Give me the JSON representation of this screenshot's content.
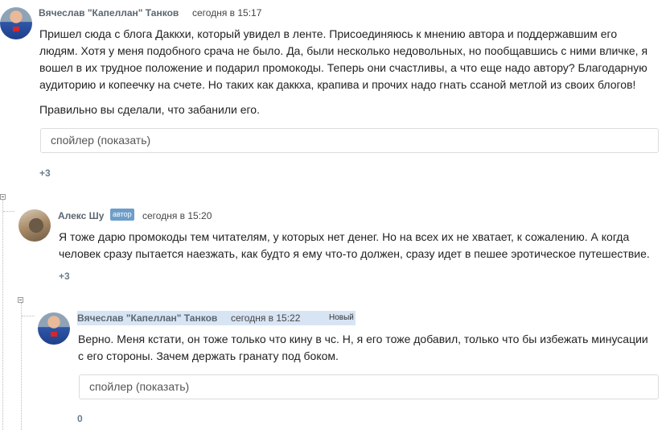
{
  "comments": [
    {
      "author": "Вячеслав \"Капеллан\" Танков",
      "time": "сегодня в 15:17",
      "lines": [
        "Пришел сюда с блога Даккхи, который увидел в ленте. Присоединяюсь к мнению автора и поддержавшим его",
        "людям. Хотя у меня подобного срача не было. Да, были несколько недовольных, но пообщавшись с ними вличке, я",
        "вошел в их трудное положение и подарил промокоды. Теперь они счастливы, а что еще надо автору? Благодарную",
        "аудиторию и копеечку на счете. Но таких как даккха, крапива и прочих надо гнать ссаной метлой из своих блогов!"
      ],
      "line2": "Правильно вы сделали, что забанили его.",
      "spoiler": "спойлер (показать)",
      "score": "+3"
    },
    {
      "author": "Алекс Шу",
      "badge": "автор",
      "time": "сегодня в 15:20",
      "lines": [
        "Я тоже дарю промокоды тем читателям, у которых нет денег. Но на всех их не хватает, к сожалению. А когда",
        "человек сразу пытается наезжать, как будто я ему что-то должен, сразу идет в пешее эротическое путешествие."
      ],
      "score": "+3"
    },
    {
      "author": "Вячеслав \"Капеллан\" Танков",
      "time": "сегодня в 15:22",
      "new_tag": "Новый",
      "lines": [
        "Верно. Меня кстати, он тоже только что кину в чс. Н, я его тоже добавил, только что бы избежать минусации",
        "с его стороны. Зачем держать гранату под боком."
      ],
      "spoiler": "спойлер (показать)",
      "score": "0"
    }
  ]
}
